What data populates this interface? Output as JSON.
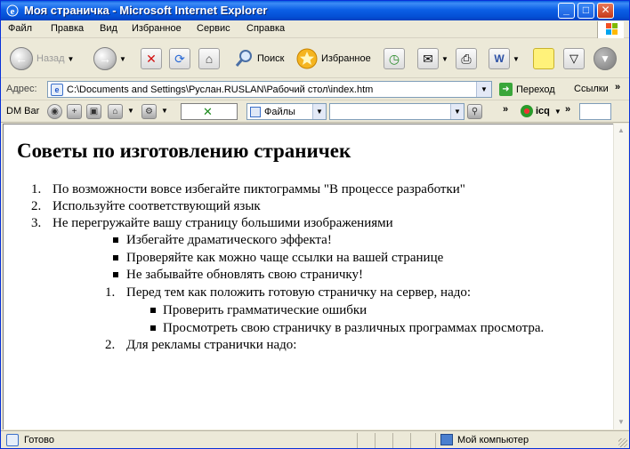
{
  "window": {
    "title": "Моя страничка - Microsoft Internet Explorer"
  },
  "menu": [
    "Файл",
    "Правка",
    "Вид",
    "Избранное",
    "Сервис",
    "Справка"
  ],
  "toolbar": {
    "back_label": "Назад",
    "search_label": "Поиск",
    "favorites_label": "Избранное"
  },
  "address_bar": {
    "label": "Адрес:",
    "url": "C:\\Documents and Settings\\Руслан.RUSLAN\\Рабочий стол\\index.htm",
    "go_label": "Переход",
    "links_label": "Ссылки"
  },
  "dm_bar": {
    "label": "DM Bar",
    "files_select": "Файлы",
    "icq_label": "icq"
  },
  "page": {
    "heading": "Советы по изготовлению страничек",
    "ol1": [
      "По возможности вовсе избегайте пиктограммы \"В процессе разработки\"",
      "Используйте соответствующий язык",
      "Не перегружайте вашу страницу большими изображениями"
    ],
    "ul1": [
      "Избегайте драматического эффекта!",
      "Проверяйте как можно чаще ссылки на вашей странице",
      "Не забывайте обновлять свою страничку!"
    ],
    "ol2_item1": "Перед тем как положить готовую страничку на сервер, надо:",
    "ul2": [
      "Проверить грамматические ошибки",
      "Просмотреть свою страничку в различных программах просмотра."
    ],
    "ol2_item2": "Для рекламы странички надо:"
  },
  "status": {
    "text": "Готово",
    "zone": "Мой компьютер"
  }
}
